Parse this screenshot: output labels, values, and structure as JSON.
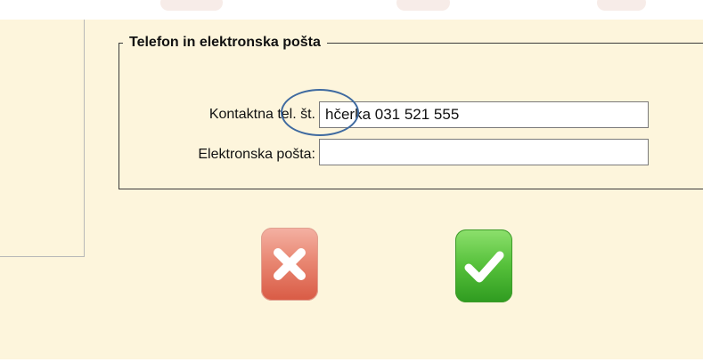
{
  "window": {
    "legend": "Telefon in elektronska pošta"
  },
  "form": {
    "phone_label": "Kontaktna tel. št.",
    "phone_value": "hčerka 031 521 555",
    "email_label": "Elektronska pošta:",
    "email_value": ""
  },
  "actions": {
    "cancel_icon": "close-x-icon",
    "confirm_icon": "checkmark-icon"
  },
  "colors": {
    "panel_bg": "#fdf5dc",
    "annotation": "#3f6aa0",
    "cancel": "#e07a66",
    "confirm": "#4bb532"
  }
}
